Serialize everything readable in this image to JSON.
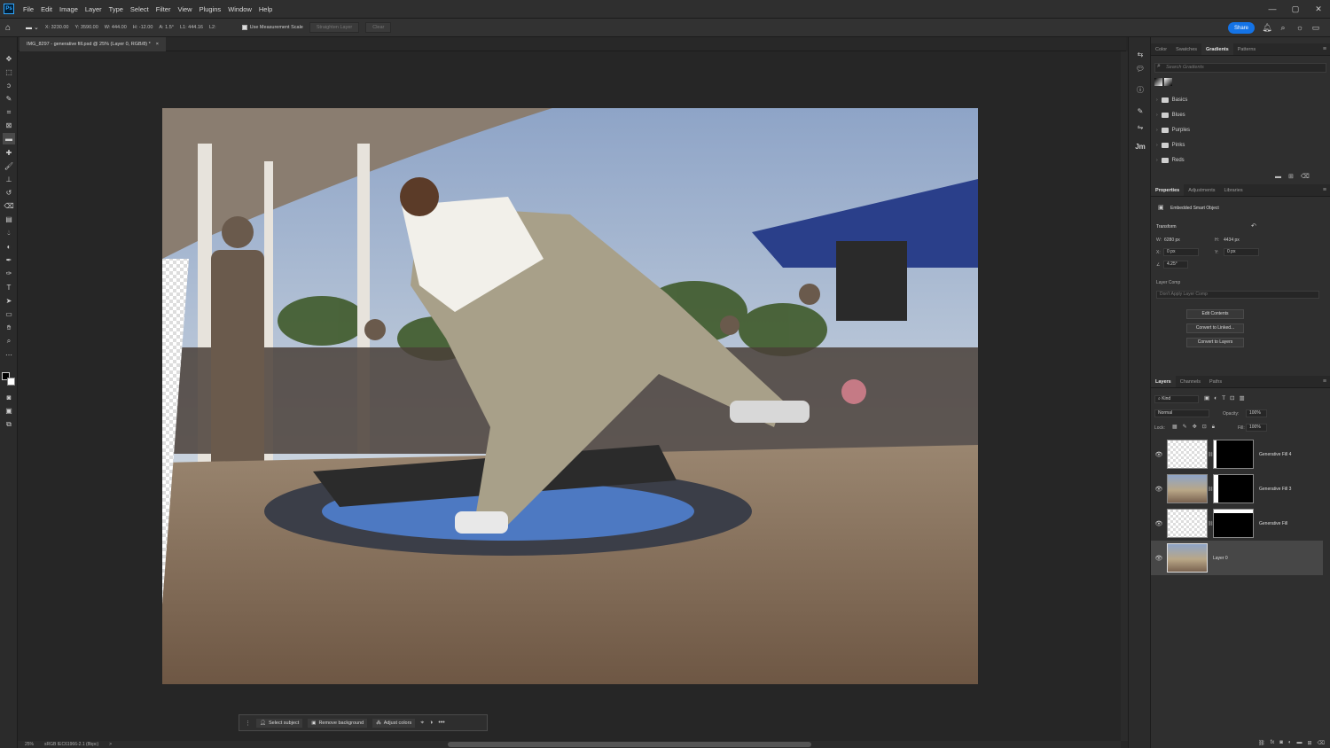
{
  "menubar": {
    "logo": "Ps",
    "items": [
      "File",
      "Edit",
      "Image",
      "Layer",
      "Type",
      "Select",
      "Filter",
      "View",
      "Plugins",
      "Window",
      "Help"
    ],
    "win_min": "—",
    "win_max": "▢",
    "win_close": "✕"
  },
  "options": {
    "x": "X: 3230.00",
    "y": "Y: 3590.00",
    "w": "W: 444.00",
    "h": "H: -12.00",
    "a": "A: 1.5°",
    "l1": "L1: 444.16",
    "l2": "L2:",
    "measurement_scale": "Use Measurement Scale",
    "straighten": "Straighten Layer",
    "clear": "Clear",
    "share": "Share"
  },
  "doc": {
    "tab_title": "IMG_8297 - generative fill.psd @ 25% (Layer 0, RGB/8) *",
    "close": "×"
  },
  "contextbar": {
    "select_subject": "Select subject",
    "remove_background": "Remove background",
    "adjust_colors": "Adjust colors",
    "more": "•••"
  },
  "status": {
    "zoom": "25%",
    "profile": "sRGB IEC61966-2.1 (8bpc)",
    "arrow": ">"
  },
  "gradients": {
    "tabs": [
      "Color",
      "Swatches",
      "Gradients",
      "Patterns"
    ],
    "search_placeholder": "Search Gradients",
    "folders": [
      "Basics",
      "Blues",
      "Purples",
      "Pinks",
      "Reds"
    ]
  },
  "properties": {
    "tabs": [
      "Properties",
      "Adjustments",
      "Libraries"
    ],
    "type": "Embedded Smart Object",
    "transform": "Transform",
    "w_label": "W:",
    "w_val": "6280 px",
    "h_label": "H:",
    "h_val": "4434 px",
    "x_label": "X:",
    "x_val": "0 px",
    "y_label": "Y:",
    "y_val": "0 px",
    "angle_val": "4.25°",
    "layer_comp_label": "Layer Comp",
    "layer_comp_val": "Don't Apply Layer Comp",
    "edit_contents": "Edit Contents",
    "convert_linked": "Convert to Linked...",
    "convert_layers": "Convert to Layers"
  },
  "layers": {
    "tabs": [
      "Layers",
      "Channels",
      "Paths"
    ],
    "kind": "Kind",
    "blend": "Normal",
    "opacity_label": "Opacity:",
    "opacity": "100%",
    "lock_label": "Lock:",
    "fill_label": "Fill:",
    "fill": "100%",
    "rows": [
      {
        "name": "Generative Fill 4"
      },
      {
        "name": "Generative Fill 3"
      },
      {
        "name": "Generative Fill"
      },
      {
        "name": "Layer 0"
      }
    ]
  }
}
